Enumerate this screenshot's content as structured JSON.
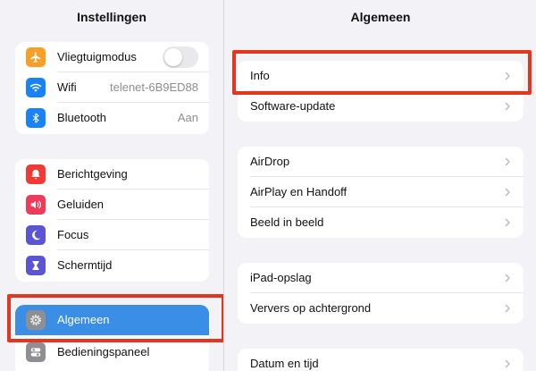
{
  "sidebar": {
    "title": "Instellingen",
    "groups": [
      {
        "items": [
          {
            "label": "Vliegtuigmodus",
            "icon": "airplane-icon",
            "color": "#f7a027",
            "value": "",
            "toggle": true
          },
          {
            "label": "Wifi",
            "icon": "wifi-icon",
            "color": "#1a82f7",
            "value": "telenet-6B9ED88"
          },
          {
            "label": "Bluetooth",
            "icon": "bluetooth-icon",
            "color": "#1a82f7",
            "value": "Aan"
          }
        ]
      },
      {
        "items": [
          {
            "label": "Berichtgeving",
            "icon": "notifications-icon",
            "color": "#f03a35"
          },
          {
            "label": "Geluiden",
            "icon": "sounds-icon",
            "color": "#f03a5a"
          },
          {
            "label": "Focus",
            "icon": "moon-icon",
            "color": "#5b55d6"
          },
          {
            "label": "Schermtijd",
            "icon": "hourglass-icon",
            "color": "#5b55d6"
          }
        ]
      },
      {
        "items": [
          {
            "label": "Algemeen",
            "icon": "gear-icon",
            "color": "#8e8e93",
            "selected": true
          },
          {
            "label": "Bedieningspaneel",
            "icon": "switches-icon",
            "color": "#8e8e93"
          }
        ]
      }
    ]
  },
  "main": {
    "title": "Algemeen",
    "groups": [
      {
        "items": [
          "Info",
          "Software-update"
        ]
      },
      {
        "items": [
          "AirDrop",
          "AirPlay en Handoff",
          "Beeld in beeld"
        ]
      },
      {
        "items": [
          "iPad-opslag",
          "Ververs op achtergrond"
        ]
      },
      {
        "items": [
          "Datum en tijd"
        ]
      }
    ]
  },
  "colors": {
    "selected_row": "#3a8ee6",
    "highlight_box": "#e5351f",
    "toggle_off": "#e9e9eb"
  }
}
